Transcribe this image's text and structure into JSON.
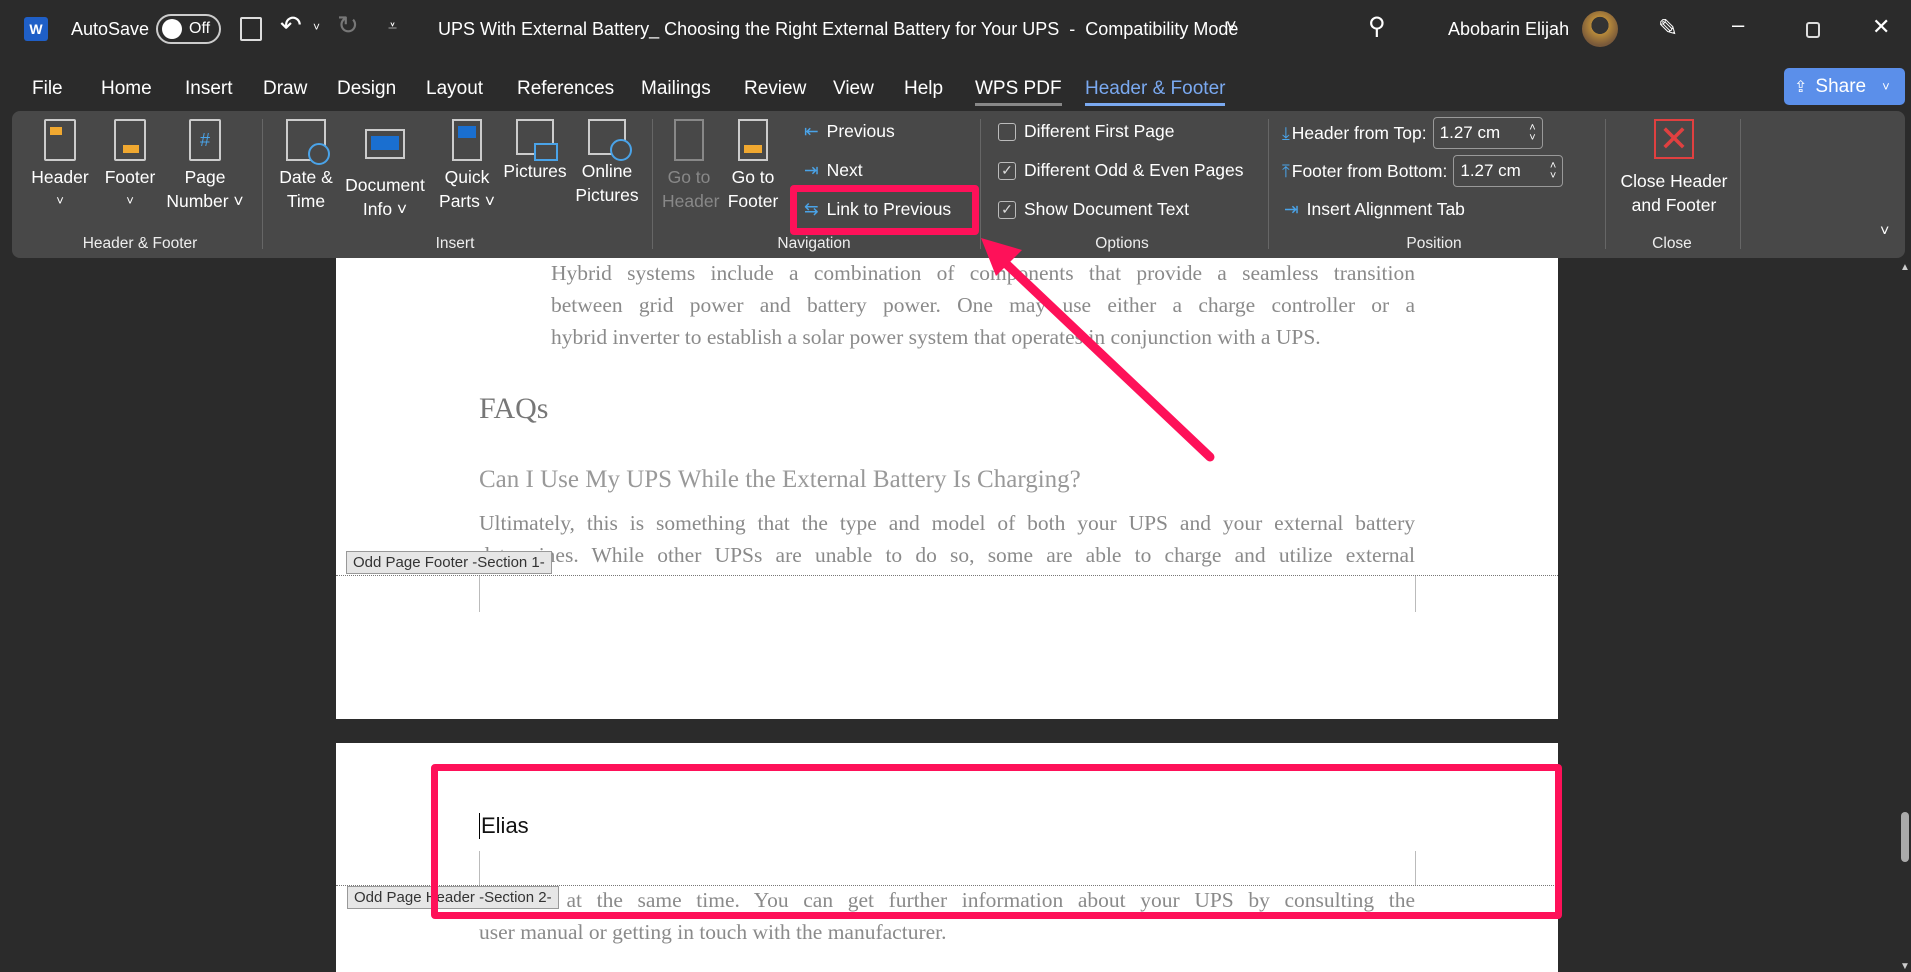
{
  "titlebar": {
    "autosave_label": "AutoSave",
    "autosave_state": "Off",
    "doc_title": "UPS With External Battery_ Choosing the Right External Battery for Your UPS  -  Compatibility Mode",
    "user_name": "Abobarin Elijah",
    "icons": [
      "word-icon",
      "save-icon",
      "undo-icon",
      "redo-icon",
      "customize-icon",
      "search-icon",
      "pen-icon",
      "minimize-icon",
      "restore-icon",
      "close-icon"
    ]
  },
  "tabs": [
    {
      "label": "File"
    },
    {
      "label": "Home"
    },
    {
      "label": "Insert"
    },
    {
      "label": "Draw"
    },
    {
      "label": "Design"
    },
    {
      "label": "Layout"
    },
    {
      "label": "References"
    },
    {
      "label": "Mailings"
    },
    {
      "label": "Review"
    },
    {
      "label": "View"
    },
    {
      "label": "Help"
    },
    {
      "label": "WPS PDF"
    },
    {
      "label": "Header & Footer",
      "active": true
    }
  ],
  "share_label": "Share",
  "accent": "#7aa9f0",
  "ribbon": {
    "groups": {
      "hf": "Header & Footer",
      "insert": "Insert",
      "nav": "Navigation",
      "options": "Options",
      "position": "Position",
      "close": "Close"
    },
    "header": [
      "Header",
      "˅"
    ],
    "footer": [
      "Footer",
      "˅"
    ],
    "page_number": [
      "Page",
      "Number ˅"
    ],
    "date_time": [
      "Date &",
      "Time"
    ],
    "doc_info": [
      "Document",
      "Info ˅"
    ],
    "quick_parts": [
      "Quick",
      "Parts ˅"
    ],
    "pictures": [
      "Pictures",
      ""
    ],
    "online_pictures": [
      "Online",
      "Pictures"
    ],
    "go_header": [
      "Go to",
      "Header"
    ],
    "go_footer": [
      "Go to",
      "Footer"
    ],
    "previous": "Previous",
    "next": "Next",
    "link_previous": "Link to Previous",
    "different_first": {
      "label": "Different First Page",
      "checked": false
    },
    "different_odd_even": {
      "label": "Different Odd & Even Pages",
      "checked": true
    },
    "show_doc_text": {
      "label": "Show Document Text",
      "checked": true
    },
    "header_top": {
      "label": "Header from Top:",
      "value": "1.27 cm"
    },
    "footer_bottom": {
      "label": "Footer from Bottom:",
      "value": "1.27 cm"
    },
    "insert_alignment": "Insert Alignment Tab",
    "close_hf": [
      "Close Header",
      "and Footer"
    ]
  },
  "doc": {
    "p1_lines": [
      "Hybrid systems include a combination of components that provide a seamless transition",
      "between grid power and battery power. One may use either a charge controller or a",
      "hybrid inverter to establish a solar power system that operates in conjunction with a UPS."
    ],
    "faqs": "FAQs",
    "question": "Can I Use My UPS While the External Battery Is Charging?",
    "p2_lines": [
      "Ultimately, this is something that the type and model of both your UPS and your external battery",
      "determines. While other UPSs are unable to do so, some are able to charge and utilize external"
    ],
    "footer_label": "Odd Page Footer -Section 1-",
    "header_text": "Elias",
    "header_label": "Odd Page Header -Section 2-",
    "p3_lines": [
      "batteries at the same time. You can get further information about your UPS by consulting the",
      "user manual or getting in touch with the manufacturer."
    ]
  },
  "annotation_color": "#fe1159"
}
